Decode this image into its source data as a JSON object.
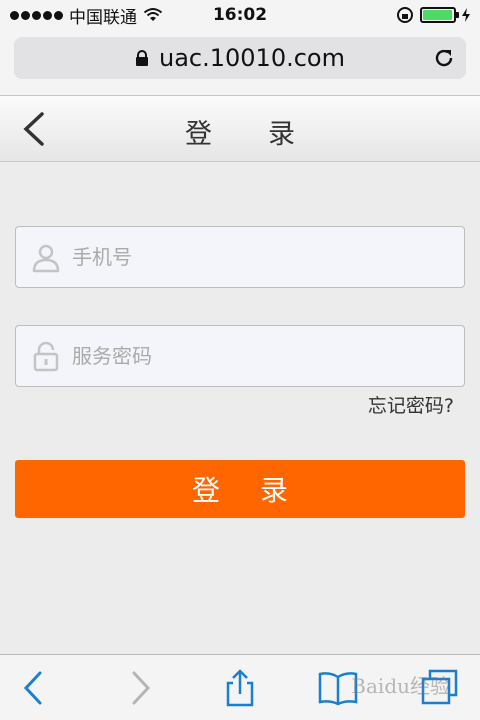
{
  "status_bar": {
    "carrier": "中国联通",
    "time": "16:02",
    "battery_level": 0.95
  },
  "browser": {
    "url": "uac.10010.com"
  },
  "header": {
    "title": "登录"
  },
  "form": {
    "phone_placeholder": "手机号",
    "password_placeholder": "服务密码",
    "forgot_link": "忘记密码?",
    "login_button": "登录"
  },
  "watermark": "Baidu经验",
  "colors": {
    "accent": "#ff6600",
    "ios_blue": "#1b7fd0",
    "battery": "#4cd964"
  },
  "icons": [
    "back-icon",
    "user-icon",
    "lock-icon",
    "reload-icon",
    "share-icon",
    "bookmarks-icon",
    "tabs-icon",
    "forward-icon"
  ]
}
